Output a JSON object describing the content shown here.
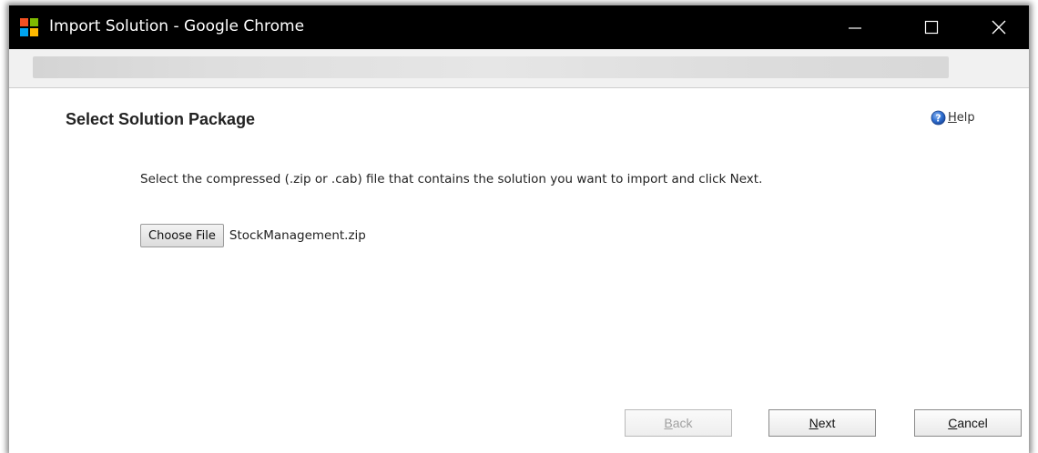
{
  "window": {
    "title": "Import Solution - Google Chrome",
    "titlebar_color": "#000000",
    "logo_colors": [
      "#f25022",
      "#7fba00",
      "#00a4ef",
      "#ffb900"
    ]
  },
  "page": {
    "title": "Select Solution Package",
    "help": {
      "icon": "help-circle-icon",
      "mnemonic": "H",
      "rest": "elp"
    },
    "instructions": "Select the compressed (.zip or .cab) file that contains the solution you want to import and click Next.",
    "file_picker": {
      "button_label": "Choose File",
      "file_name": "StockManagement.zip"
    }
  },
  "buttons": {
    "back": {
      "mnemonic": "B",
      "rest": "ack",
      "enabled": false
    },
    "next": {
      "mnemonic": "N",
      "rest": "ext",
      "enabled": true
    },
    "cancel": {
      "mnemonic": "C",
      "rest": "ancel",
      "enabled": true
    }
  }
}
